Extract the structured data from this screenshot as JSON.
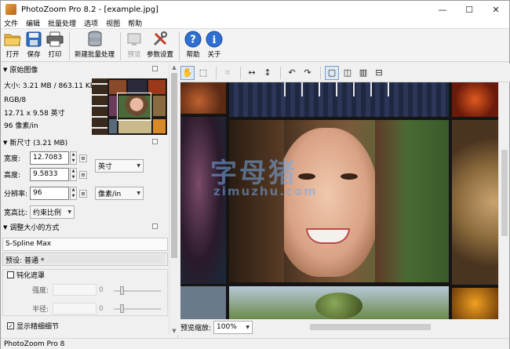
{
  "window": {
    "title": "PhotoZoom Pro 8.2 - [example.jpg]",
    "controls": [
      "—",
      "☐",
      "✕"
    ]
  },
  "menu": [
    "文件",
    "编辑",
    "批量处理",
    "选项",
    "视图",
    "帮助"
  ],
  "toolbar": {
    "open": "打开",
    "save": "保存",
    "print": "打印",
    "new_batch": "新建批量处理",
    "preview": "预览",
    "settings": "参数设置",
    "help": "帮助",
    "about": "关于"
  },
  "original": {
    "header": "原始图像",
    "size": "大小: 3.21 MB / 863.11 KB",
    "mode": "RGB/8",
    "dimensions": "12.71 x 9.58 英寸",
    "resolution": "96 像素/in"
  },
  "new_size": {
    "header": "新尺寸 (3.21 MB)",
    "width_label": "宽度:",
    "width_value": "12.7083",
    "height_label": "高度:",
    "height_value": "9.5833",
    "res_label": "分辨率:",
    "res_value": "96",
    "unit": "英寸",
    "res_unit": "像素/in",
    "aspect_label": "宽高比:",
    "aspect_value": "约束比例"
  },
  "resize": {
    "header": "调整大小的方式",
    "method": "S-Spline Max",
    "preset_label": "预设:",
    "preset_value": "普通 *",
    "sharpen_label": "钝化遮罩",
    "strength_label": "强度:",
    "radius_label": "半径:",
    "strength_value": "0",
    "radius_value": "0",
    "show_fine": "显示精细细节"
  },
  "preview": {
    "zoom_label": "预览缩放:",
    "zoom_value": "100%"
  },
  "watermark": {
    "main": "字母猪",
    "sub": "zimuzhu.com"
  },
  "status": "PhotoZoom Pro 8"
}
